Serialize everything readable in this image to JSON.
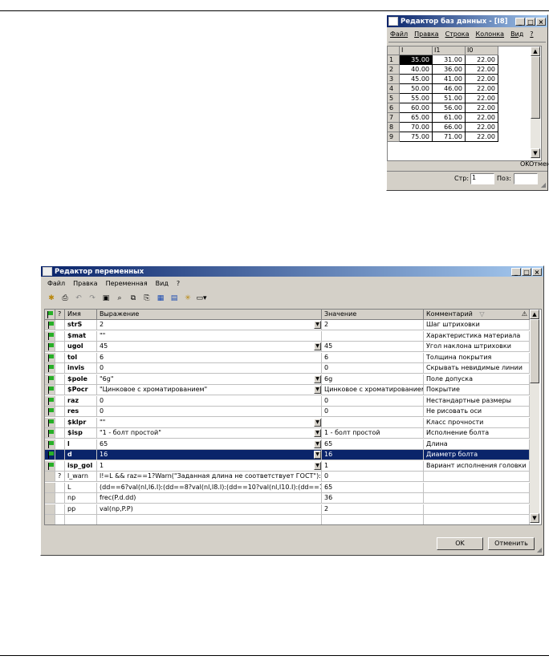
{
  "db_window": {
    "title": "Редактор баз данных - [I8]",
    "menu": [
      "Файл",
      "Правка",
      "Строка",
      "Колонка",
      "Вид",
      "?"
    ],
    "columns": [
      "I",
      "I1",
      "I0"
    ],
    "rows": [
      {
        "n": "1",
        "c": [
          "35.00",
          "31.00",
          "22.00"
        ]
      },
      {
        "n": "2",
        "c": [
          "40.00",
          "36.00",
          "22.00"
        ]
      },
      {
        "n": "3",
        "c": [
          "45.00",
          "41.00",
          "22.00"
        ]
      },
      {
        "n": "4",
        "c": [
          "50.00",
          "46.00",
          "22.00"
        ]
      },
      {
        "n": "5",
        "c": [
          "55.00",
          "51.00",
          "22.00"
        ]
      },
      {
        "n": "6",
        "c": [
          "60.00",
          "56.00",
          "22.00"
        ]
      },
      {
        "n": "7",
        "c": [
          "65.00",
          "61.00",
          "22.00"
        ]
      },
      {
        "n": "8",
        "c": [
          "70.00",
          "66.00",
          "22.00"
        ]
      },
      {
        "n": "9",
        "c": [
          "75.00",
          "71.00",
          "22.00"
        ]
      }
    ],
    "ok_label": "OK",
    "cancel_label": "Отмена",
    "page_label": "Стр:",
    "page_value": "1",
    "pos_label": "Поз:"
  },
  "var_window": {
    "title": "Редактор переменных",
    "menu": [
      "Файл",
      "Правка",
      "Переменная",
      "Вид",
      "?"
    ],
    "headers": {
      "q": "?",
      "name": "Имя",
      "expr": "Выражение",
      "value": "Значение",
      "comment": "Комментарий"
    },
    "rows": [
      {
        "flag": true,
        "q": "",
        "name": "strS",
        "expr": "2",
        "dd": true,
        "value": "2",
        "comment": "Шаг штриховки",
        "bold": true
      },
      {
        "flag": true,
        "q": "",
        "name": "$mat",
        "expr": "\"\"",
        "dd": false,
        "value": "",
        "comment": "Характеристика материала",
        "bold": true
      },
      {
        "flag": true,
        "q": "",
        "name": "ugol",
        "expr": "45",
        "dd": true,
        "value": "45",
        "comment": "Угол наклона штриховки",
        "bold": true
      },
      {
        "flag": true,
        "q": "",
        "name": "tol",
        "expr": "6",
        "dd": false,
        "value": "6",
        "comment": "Толщина покрытия",
        "bold": true
      },
      {
        "flag": true,
        "q": "",
        "name": "invis",
        "expr": "0",
        "dd": false,
        "value": "0",
        "comment": "Скрывать невидимые линии",
        "bold": true
      },
      {
        "flag": true,
        "q": "",
        "name": "$pole",
        "expr": "\"6g\"",
        "dd": true,
        "value": "6g",
        "comment": "Поле допуска",
        "bold": true
      },
      {
        "flag": true,
        "q": "",
        "name": "$Pocr",
        "expr": "\"Цинковое с хроматированием\"",
        "dd": true,
        "value": "Цинковое с хроматированием",
        "comment": "Покрытие",
        "bold": true
      },
      {
        "flag": true,
        "q": "",
        "name": "raz",
        "expr": "0",
        "dd": false,
        "value": "0",
        "comment": "Нестандартные  размеры",
        "bold": true
      },
      {
        "flag": true,
        "q": "",
        "name": "res",
        "expr": "0",
        "dd": false,
        "value": "0",
        "comment": "Не рисовать оси",
        "bold": true
      },
      {
        "flag": true,
        "q": "",
        "name": "$klpr",
        "expr": "\"\"",
        "dd": true,
        "value": "",
        "comment": "Класс прочности",
        "bold": true
      },
      {
        "flag": true,
        "q": "",
        "name": "$isp",
        "expr": "\"1 - болт простой\"",
        "dd": true,
        "value": "1 - болт простой",
        "comment": "Исполнение болта",
        "bold": true
      },
      {
        "flag": true,
        "q": "",
        "name": "l",
        "expr": "65",
        "dd": true,
        "value": "65",
        "comment": "Длина",
        "bold": true
      },
      {
        "flag": true,
        "q": "",
        "name": "d",
        "expr": "16",
        "dd": true,
        "value": "16",
        "comment": "Диаметр болта",
        "bold": true,
        "sel": true
      },
      {
        "flag": true,
        "q": "",
        "name": "isp_gol",
        "expr": "1",
        "dd": true,
        "value": "1",
        "comment": "Вариант исполнения головки",
        "bold": true
      },
      {
        "flag": false,
        "q": "?",
        "name": "l_warn",
        "expr": "l!=L && raz==1?Warn(\"Заданная длина не соответствует ГОСТ\"):0",
        "dd": false,
        "value": "0",
        "comment": "",
        "bold": false
      },
      {
        "flag": false,
        "q": "",
        "name": "L",
        "expr": "(dd==6?val(nl,I6.I):(dd==8?val(nl,I8.I):(dd==10?val(nl,I10.I):(dd==12?val(nl,I12...",
        "dd": false,
        "value": "65",
        "comment": "",
        "bold": false
      },
      {
        "flag": false,
        "q": "",
        "name": "np",
        "expr": "frec(P.d.dd)",
        "dd": false,
        "value": "36",
        "comment": "",
        "bold": false
      },
      {
        "flag": false,
        "q": "",
        "name": "pp",
        "expr": "val(np,P.P)",
        "dd": false,
        "value": "2",
        "comment": "",
        "bold": false
      },
      {
        "flag": false,
        "q": "",
        "name": "",
        "expr": "",
        "dd": false,
        "value": "",
        "comment": "",
        "bold": false
      }
    ],
    "ok_label": "OK",
    "cancel_label": "Отменить"
  }
}
